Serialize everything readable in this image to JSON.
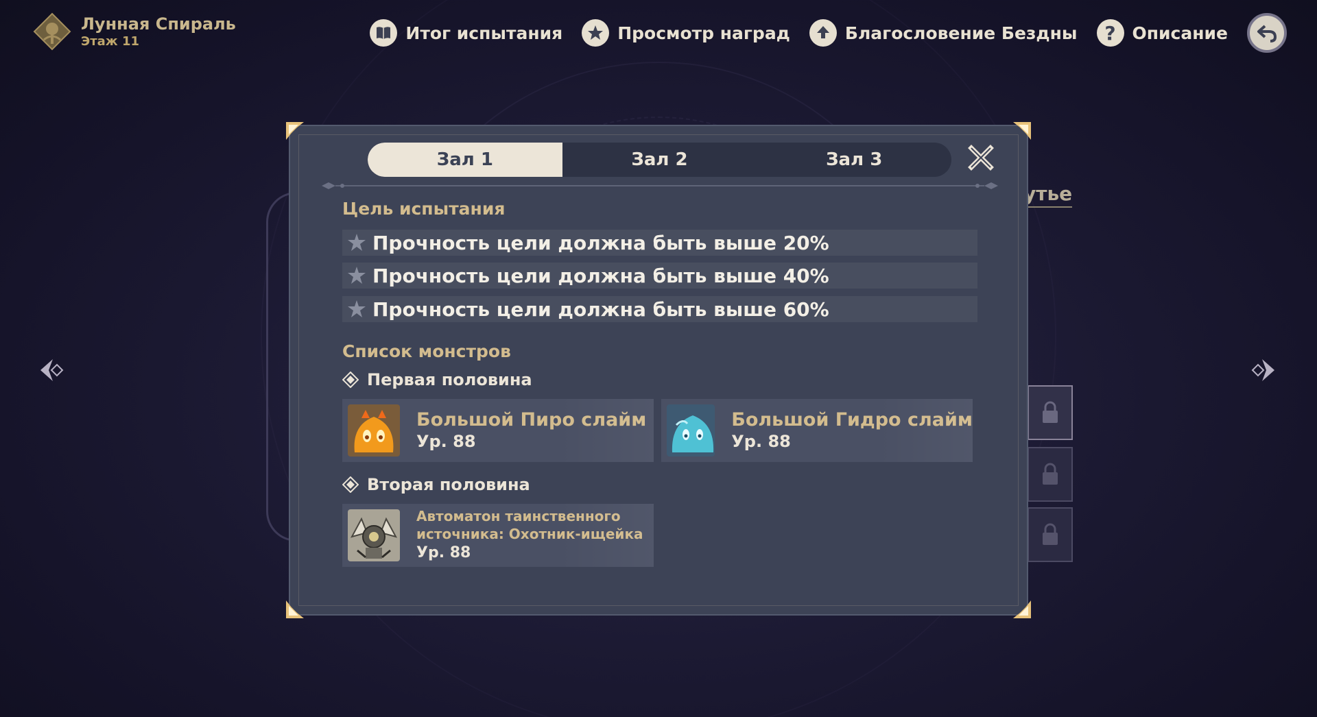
{
  "header": {
    "title": "Лунная Спираль",
    "subtitle": "Этаж 11"
  },
  "nav": {
    "items": [
      {
        "label": "Итог испытания",
        "icon": "book-icon"
      },
      {
        "label": "Просмотр наград",
        "icon": "star-badge-icon"
      },
      {
        "label": "Благословение Бездны",
        "icon": "upload-arrow-icon"
      },
      {
        "label": "Описание",
        "icon": "question-icon"
      }
    ],
    "back_icon": "back-arrow-icon"
  },
  "background": {
    "partial_label": "утье"
  },
  "modal": {
    "tabs": [
      "Зал 1",
      "Зал 2",
      "Зал 3"
    ],
    "active_tab": 0,
    "challenge_title": "Цель испытания",
    "requirements": [
      "Прочность цели должна быть выше 20%",
      "Прочность цели должна быть выше 40%",
      "Прочность цели должна быть выше 60%"
    ],
    "monsters_title": "Список монстров",
    "first_half": {
      "label": "Первая половина",
      "monsters": [
        {
          "name": "Большой Пиро слайм",
          "level": "Ур. 88",
          "icon": "pyro-slime-icon",
          "color": "#f4a323"
        },
        {
          "name": "Большой Гидро слайм",
          "level": "Ур. 88",
          "icon": "hydro-slime-icon",
          "color": "#4fc1d4"
        }
      ]
    },
    "second_half": {
      "label": "Вторая половина",
      "monsters": [
        {
          "name_line1": "Автоматон таинственного",
          "name_line2": "источника: Охотник-ищейка",
          "level": "Ур. 88",
          "icon": "automaton-icon"
        }
      ]
    }
  },
  "colors": {
    "accent_gold": "#d3bc8e",
    "modal_bg": "#3d4356",
    "tab_active": "#ece5d8"
  }
}
